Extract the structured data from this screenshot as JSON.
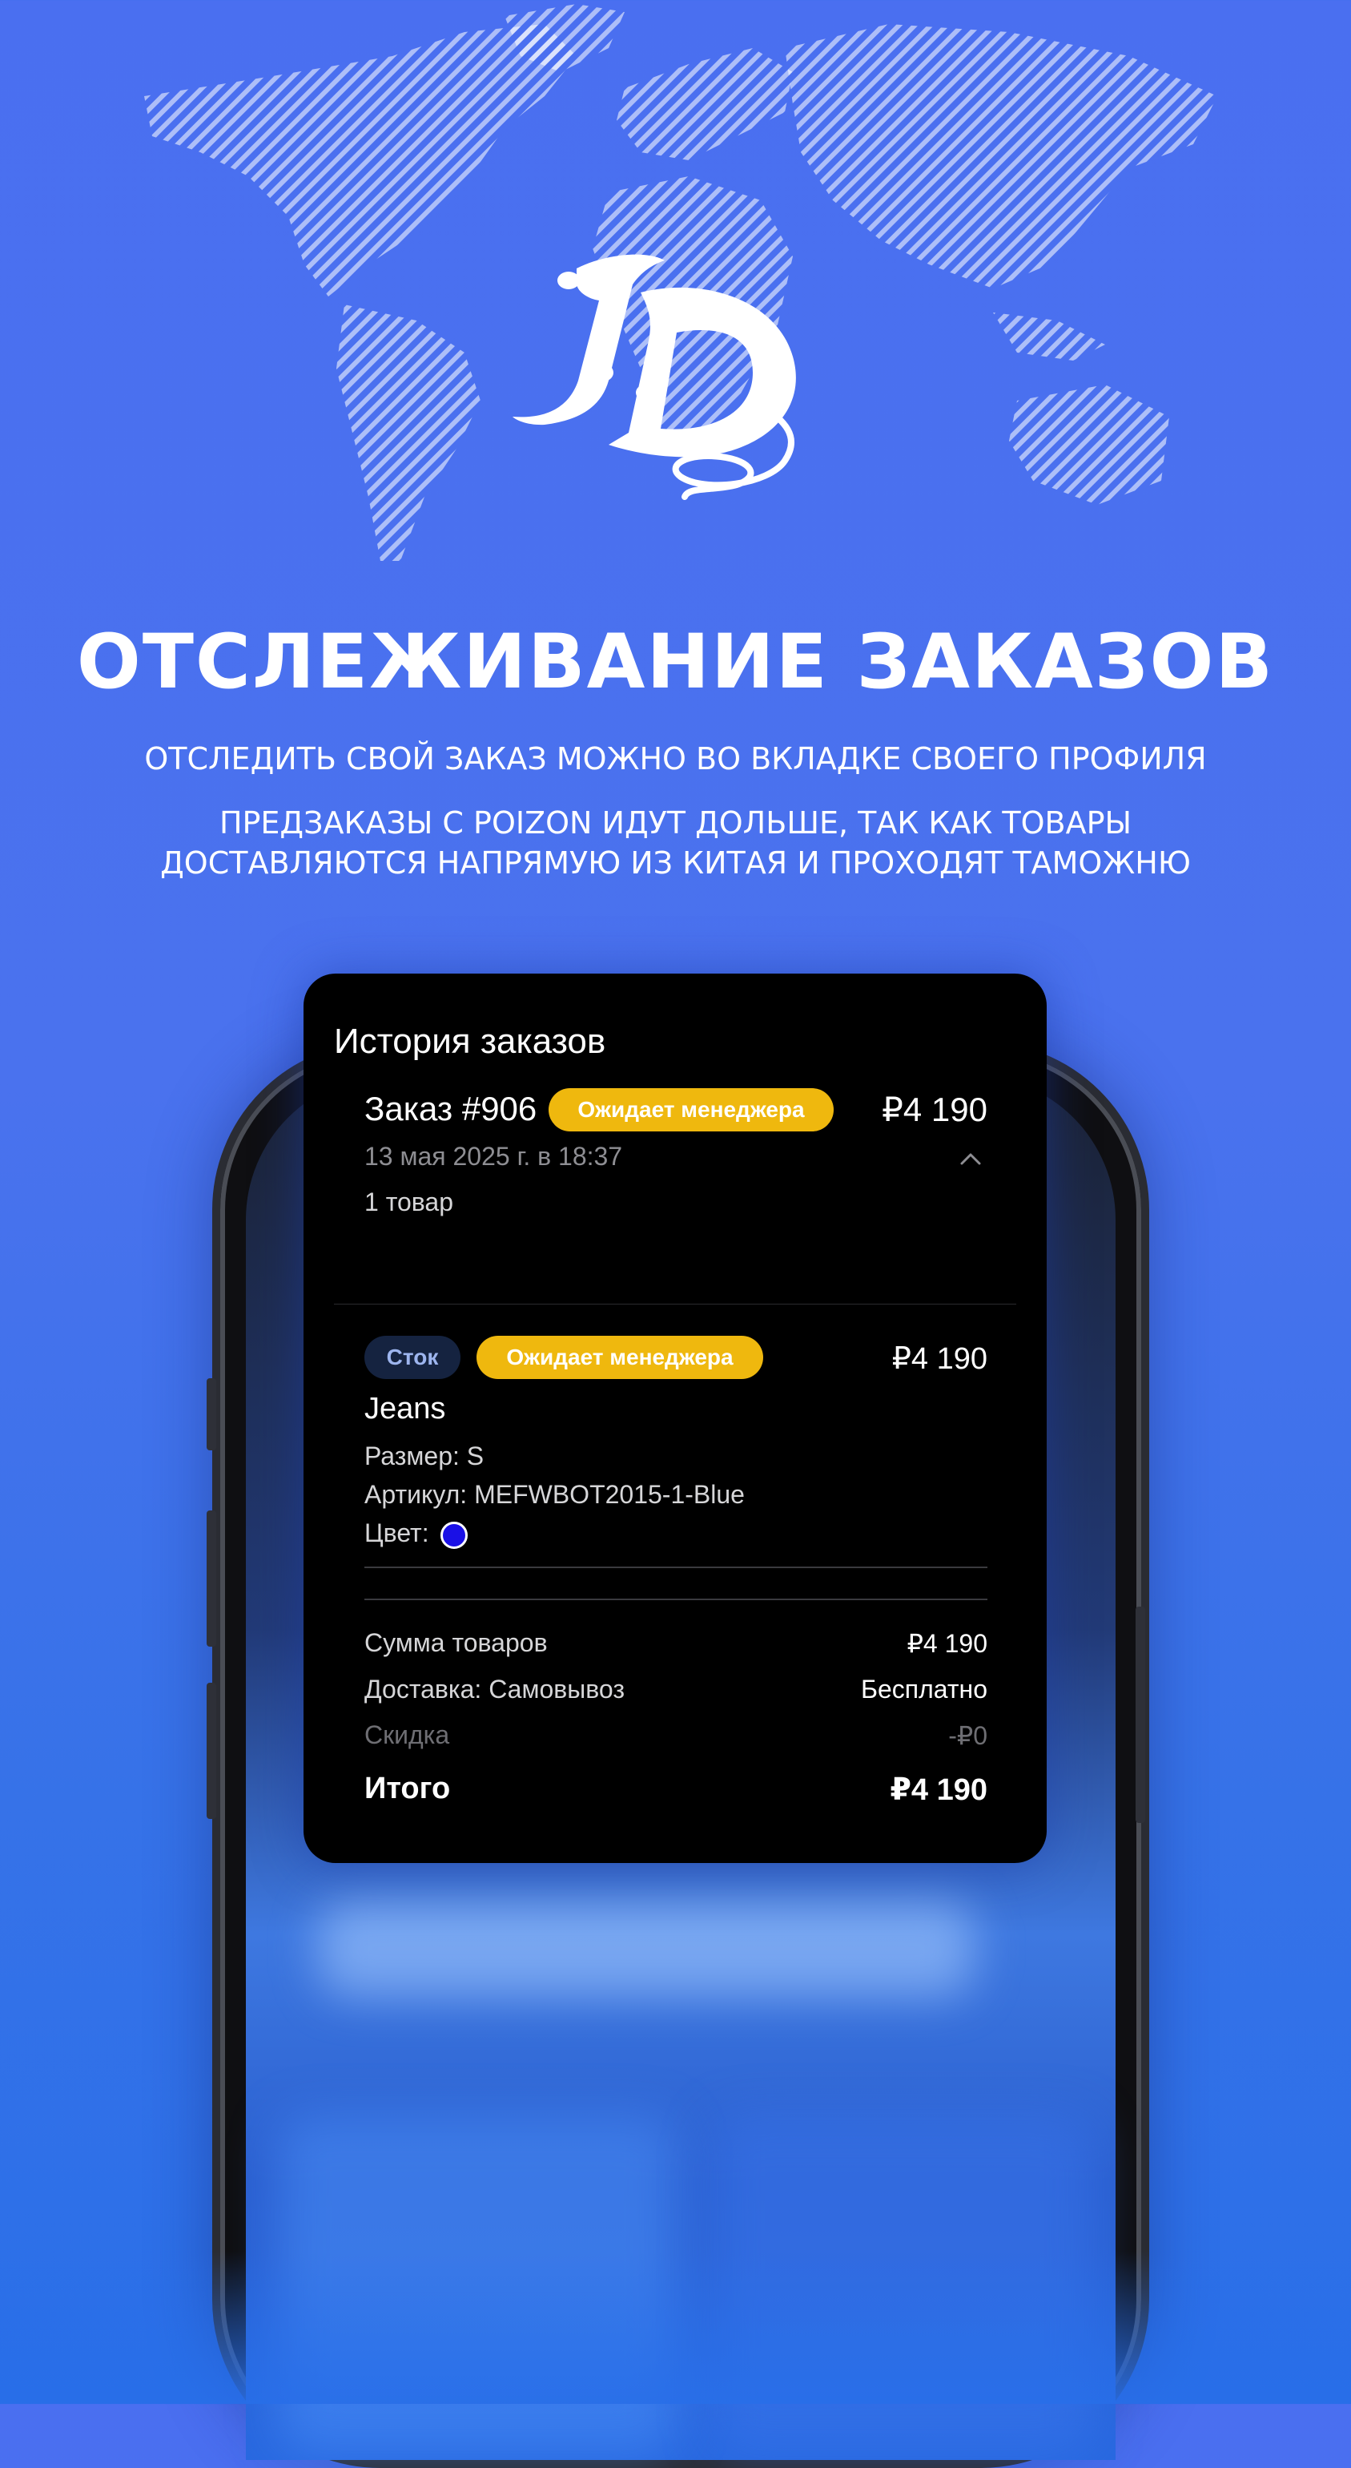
{
  "hero": {
    "title": "ОТСЛЕЖИВАНИЕ ЗАКАЗОВ",
    "line1": "ОТСЛЕДИТЬ СВОЙ ЗАКАЗ МОЖНО ВО ВКЛАДКЕ СВОЕГО ПРОФИЛЯ",
    "line2": "ПРЕДЗАКАЗЫ С POIZON ИДУТ ДОЛЬШЕ, ТАК КАК ТОВАРЫ",
    "line3": "ДОСТАВЛЯЮТСЯ  НАПРЯМУЮ ИЗ КИТАЯ И ПРОХОДЯТ ТАМОЖНЮ"
  },
  "colors": {
    "background": "#4a6ff0",
    "card": "#000000",
    "badge": "#efb80e",
    "stock_tag": "#152340",
    "item_color": "#1a10e6"
  },
  "card": {
    "title": "История заказов",
    "order": {
      "number": "Заказ #906",
      "status": "Ожидает менеджера",
      "price": "₽4 190",
      "date": "13 мая 2025 г. в 18:37",
      "count": "1 товар",
      "chevron_icon": "chevron-up-icon"
    },
    "item": {
      "tag": "Сток",
      "status": "Ожидает менеджера",
      "price": "₽4 190",
      "name": "Jeans",
      "size": "Размер: S",
      "sku": "Артикул: MEFWBOT2015-1-Blue",
      "color_label": "Цвет:"
    },
    "summary": {
      "goods_label": "Сумма товаров",
      "goods_value": "₽4 190",
      "delivery_label": "Доставка: Самовывоз",
      "delivery_value": "Бесплатно",
      "discount_label": "Скидка",
      "discount_value": "-₽0",
      "total_label": "Итого",
      "total_value": "₽4 190"
    }
  }
}
